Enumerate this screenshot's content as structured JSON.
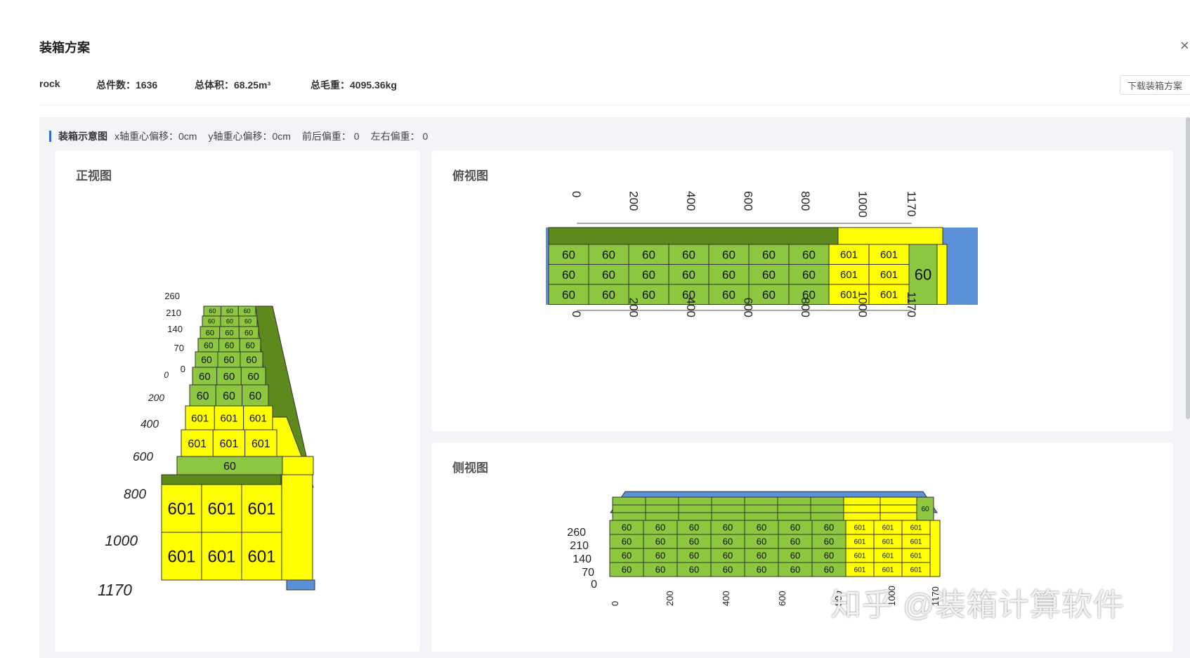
{
  "modal": {
    "title": "装箱方案",
    "close": "×",
    "download_label": "下载装箱方案"
  },
  "stats": {
    "name": "rock",
    "total_count": "总件数：1636",
    "total_volume": "总体积：68.25m³",
    "total_weight": "总毛重：4095.36kg"
  },
  "section": {
    "title": "装箱示意图",
    "x_offset": "x轴重心偏移：0cm",
    "y_offset": "y轴重心偏移：0cm",
    "front_back": "前后偏重：  0",
    "left_right": "左右偏重：  0"
  },
  "views": {
    "front": {
      "title": "正视图"
    },
    "top": {
      "title": "俯视图"
    },
    "side": {
      "title": "侧视图"
    }
  },
  "box_labels": {
    "a": "60",
    "b": "601"
  },
  "axis_ticks": {
    "length": [
      "0",
      "200",
      "400",
      "600",
      "800",
      "1000",
      "1170"
    ],
    "height": [
      "0",
      "70",
      "140",
      "210",
      "260"
    ]
  },
  "colors": {
    "green": "#8dc63f",
    "yellow": "#ffff00",
    "blue": "#5b8fd8",
    "dark_green": "#5d8a1c",
    "accent": "#2d6bd6"
  },
  "watermark": "知乎 @装箱计算软件"
}
